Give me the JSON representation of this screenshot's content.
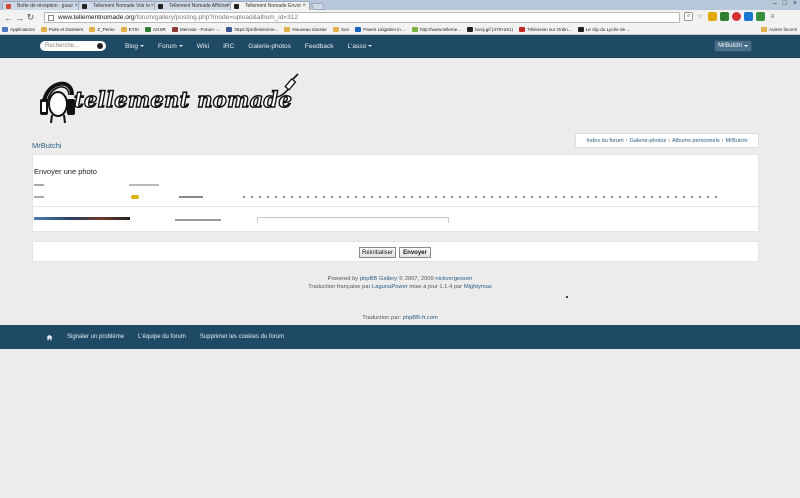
{
  "browser": {
    "tabs": [
      {
        "label": "Boîte de réception - jpaul",
        "favicon_color": "#d44638"
      },
      {
        "label": "Tellement Nomade Voir le",
        "favicon_color": "#222222"
      },
      {
        "label": "Tellement Nomade Afficher",
        "favicon_color": "#222222"
      },
      {
        "label": "Tellement Nomade Envoi",
        "favicon_color": "#222222",
        "active": true
      }
    ],
    "url_host": "www.tellementnomade.org",
    "url_path": "/forum/gallery/posting.php?mode=upload&album_id=312",
    "bookmarks": [
      {
        "label": "Applications",
        "icon_color": "#4a78c2"
      },
      {
        "label": "Puits et Dossiers",
        "icon_color": "#e3b14b"
      },
      {
        "label": "Z_Perso",
        "icon_color": "#e3b14b"
      },
      {
        "label": "ETSI",
        "icon_color": "#e3b14b"
      },
      {
        "label": "AGSR",
        "icon_color": "#2e7d32"
      },
      {
        "label": "Mercato - Forum -...",
        "icon_color": "#8b3a3a"
      },
      {
        "label": "https://professionne...",
        "icon_color": "#3b5998"
      },
      {
        "label": "Nouveau dossier",
        "icon_color": "#e3b14b"
      },
      {
        "label": "Son",
        "icon_color": "#e3b14b"
      },
      {
        "label": "Patent Litigation in ...",
        "icon_color": "#1565c0"
      },
      {
        "label": "http://www.telleme...",
        "icon_color": "#7cb342"
      },
      {
        "label": "bivoj.gif (470×261)",
        "icon_color": "#222222"
      },
      {
        "label": "Télévision sur Ordin...",
        "icon_color": "#c62828"
      },
      {
        "label": "Le clip du Lycée de ...",
        "icon_color": "#222222"
      }
    ],
    "other_bookmarks": "Autres favoris"
  },
  "nav": {
    "search_placeholder": "Recherche...",
    "items": [
      {
        "label": "Blog",
        "dropdown": true
      },
      {
        "label": "Forum",
        "dropdown": true
      },
      {
        "label": "Wiki",
        "dropdown": false
      },
      {
        "label": "IRC",
        "dropdown": false
      },
      {
        "label": "Galerie-photos",
        "dropdown": false
      },
      {
        "label": "Feedback",
        "dropdown": false
      },
      {
        "label": "L'asso",
        "dropdown": true
      }
    ],
    "user_label": "MrButchi"
  },
  "logo_text": "tellement nomade",
  "username_link": "MrButchi",
  "breadcrumb": [
    "Index du forum",
    "Galerie-photos",
    "Albums personnels",
    "MrButchi"
  ],
  "panel": {
    "title": "Envoyer une photo"
  },
  "buttons": {
    "reset": "Réinitialiser",
    "submit": "Envoyer"
  },
  "credits": {
    "line1_prefix": "Powered by ",
    "line1_link1": "phpBB Gallery",
    "line1_mid": " © 2007, 2009 ",
    "line1_link2": "nickvergessen",
    "line2_prefix": "Traduction française par ",
    "line2_link1": "LagunaPower",
    "line2_mid": " mise à jour 1.1.4 par ",
    "line2_link2": "Mightymax",
    "line3_prefix": "Traduction par: ",
    "line3_link": "phpBB-fr.com"
  },
  "footer": {
    "items": [
      "Signaler un problème",
      "L'équipe du forum",
      "Supprimer les cookies du forum"
    ]
  },
  "colors": {
    "nav_bg": "#1f4a66",
    "link": "#2a5d84",
    "page_bg": "#ececec"
  }
}
